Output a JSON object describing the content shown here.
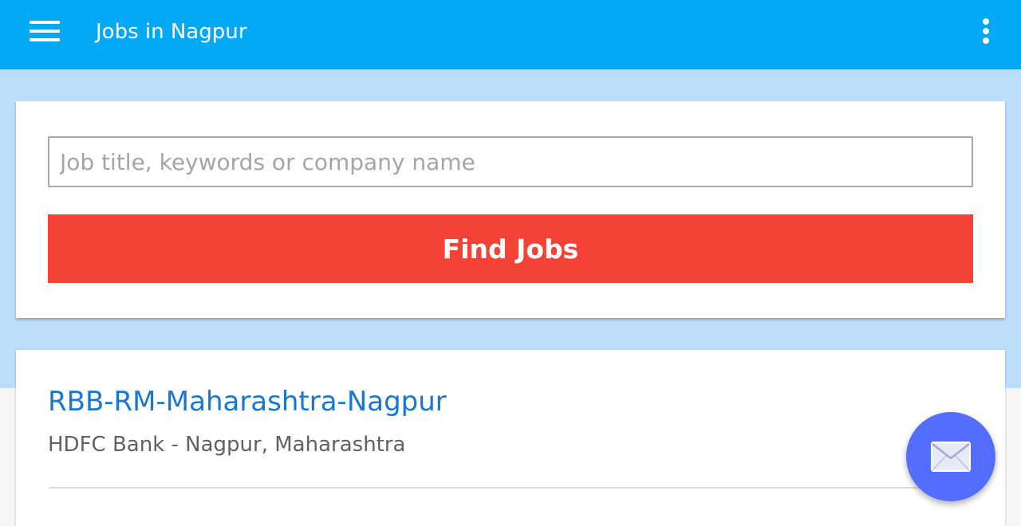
{
  "appbar": {
    "title": "Jobs in Nagpur",
    "menu_icon": "hamburger-menu-icon",
    "overflow_icon": "more-vert-icon"
  },
  "search": {
    "placeholder": "Job title, keywords or company name",
    "value": "",
    "button_label": "Find Jobs"
  },
  "results": {
    "items": [
      {
        "title": "RBB-RM-Maharashtra-Nagpur",
        "subtitle": "HDFC Bank - Nagpur, Maharashtra"
      }
    ]
  },
  "fab": {
    "icon": "email-icon"
  },
  "colors": {
    "primary": "#03a9f4",
    "band": "#bbdefb",
    "accent": "#f44336",
    "link": "#1976d2",
    "fab": "#536dfe"
  }
}
